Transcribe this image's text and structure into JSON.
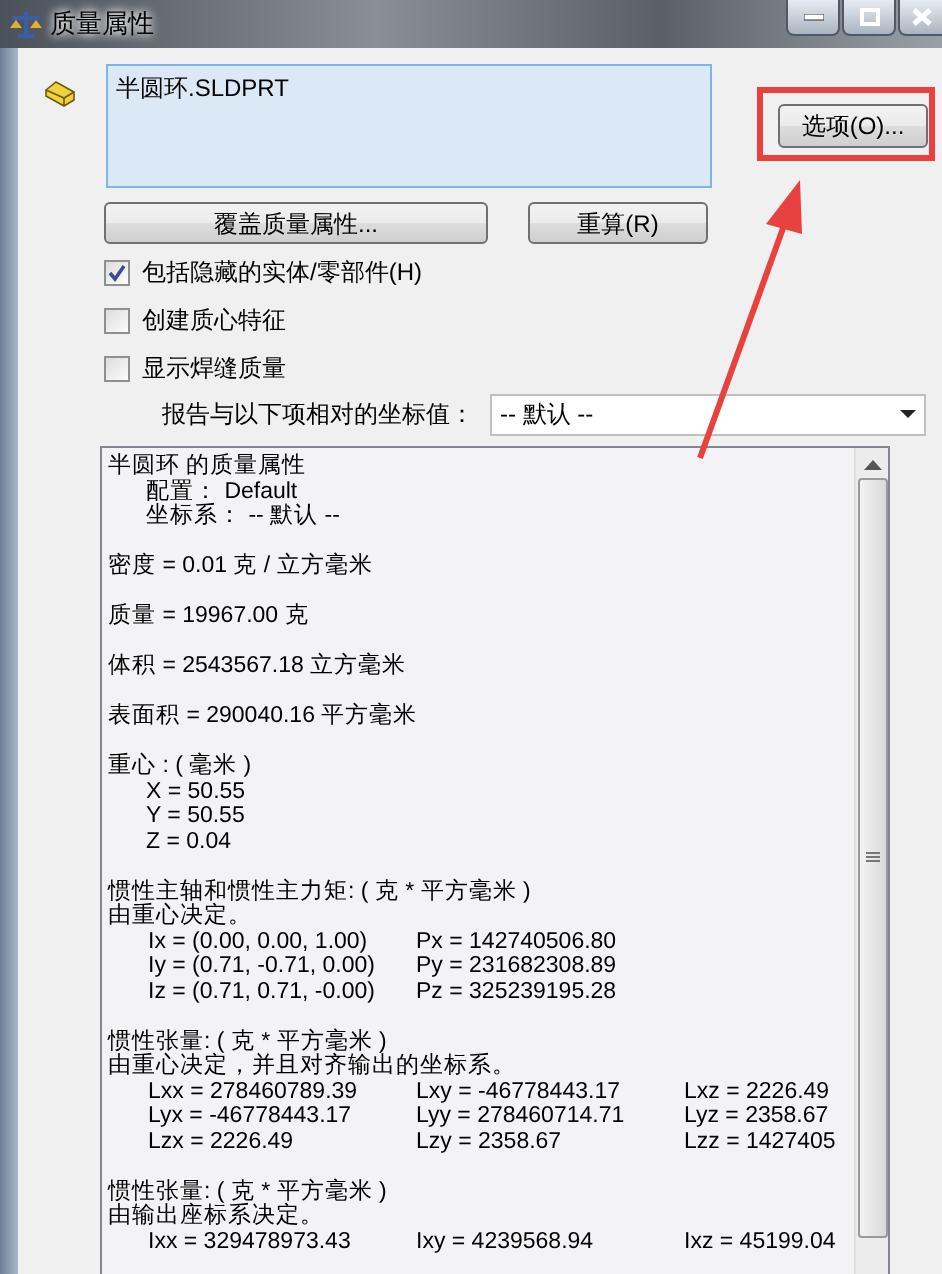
{
  "window": {
    "title": "质量属性"
  },
  "selection_list": {
    "items": [
      "半圆环.SLDPRT"
    ]
  },
  "buttons": {
    "options": "选项(O)...",
    "override": "覆盖质量属性...",
    "recalculate": "重算(R)"
  },
  "checkboxes": [
    {
      "label": "包括隐藏的实体/零部件(H)",
      "checked": true
    },
    {
      "label": "创建质心特征",
      "checked": false
    },
    {
      "label": "显示焊缝质量",
      "checked": false
    }
  ],
  "coordinate": {
    "label": "报告与以下项相对的坐标值：",
    "value": "-- 默认 --"
  },
  "report": {
    "sections": [
      {
        "lines": [
          {
            "kind": "plain",
            "text": "半圆环 的质量属性"
          },
          {
            "kind": "sub",
            "text": "配置： Default"
          },
          {
            "kind": "sub",
            "text": "坐标系： -- 默认 --"
          }
        ]
      },
      {
        "lines": [
          {
            "kind": "plain",
            "text": "密度 = 0.01 克 / 立方毫米"
          }
        ]
      },
      {
        "lines": [
          {
            "kind": "plain",
            "text": "质量 = 19967.00 克"
          }
        ]
      },
      {
        "lines": [
          {
            "kind": "plain",
            "text": "体积 = 2543567.18 立方毫米"
          }
        ]
      },
      {
        "lines": [
          {
            "kind": "plain",
            "text": "表面积 = 290040.16  平方毫米"
          }
        ]
      },
      {
        "lines": [
          {
            "kind": "plain",
            "text": "重心 : ( 毫米 )"
          },
          {
            "kind": "sub",
            "text": "X = 50.55"
          },
          {
            "kind": "sub",
            "text": "Y = 50.55"
          },
          {
            "kind": "sub",
            "text": "Z = 0.04"
          }
        ]
      },
      {
        "lines": [
          {
            "kind": "plain",
            "text": "惯性主轴和惯性主力矩: ( 克 *  平方毫米 )"
          },
          {
            "kind": "plain",
            "text": "由重心决定。"
          },
          {
            "kind": "values",
            "cells": [
              "Ix = (0.00, 0.00, 1.00)",
              "Px = 142740506.80"
            ]
          },
          {
            "kind": "values",
            "cells": [
              "Iy = (0.71, -0.71, 0.00)",
              "Py = 231682308.89"
            ]
          },
          {
            "kind": "values",
            "cells": [
              "Iz = (0.71, 0.71, -0.00)",
              "Pz = 325239195.28"
            ]
          }
        ]
      },
      {
        "lines": [
          {
            "kind": "plain",
            "text": "惯性张量: ( 克 *  平方毫米 )"
          },
          {
            "kind": "plain",
            "text": "由重心决定，并且对齐输出的坐标系。"
          },
          {
            "kind": "values",
            "cells": [
              "Lxx = 278460789.39",
              "Lxy = -46778443.17",
              "Lxz = 2226.49"
            ]
          },
          {
            "kind": "values",
            "cells": [
              "Lyx = -46778443.17",
              "Lyy = 278460714.71",
              "Lyz = 2358.67"
            ]
          },
          {
            "kind": "values",
            "cells": [
              "Lzx = 2226.49",
              "Lzy = 2358.67",
              "Lzz = 1427405"
            ]
          }
        ]
      },
      {
        "lines": [
          {
            "kind": "plain",
            "text": "惯性张量: ( 克 *  平方毫米 )"
          },
          {
            "kind": "plain",
            "text": "由输出座标系决定。"
          },
          {
            "kind": "values",
            "cells": [
              "Ixx = 329478973.43",
              "Ixy = 4239568.94",
              "Ixz = 45199.04"
            ]
          }
        ]
      }
    ]
  }
}
